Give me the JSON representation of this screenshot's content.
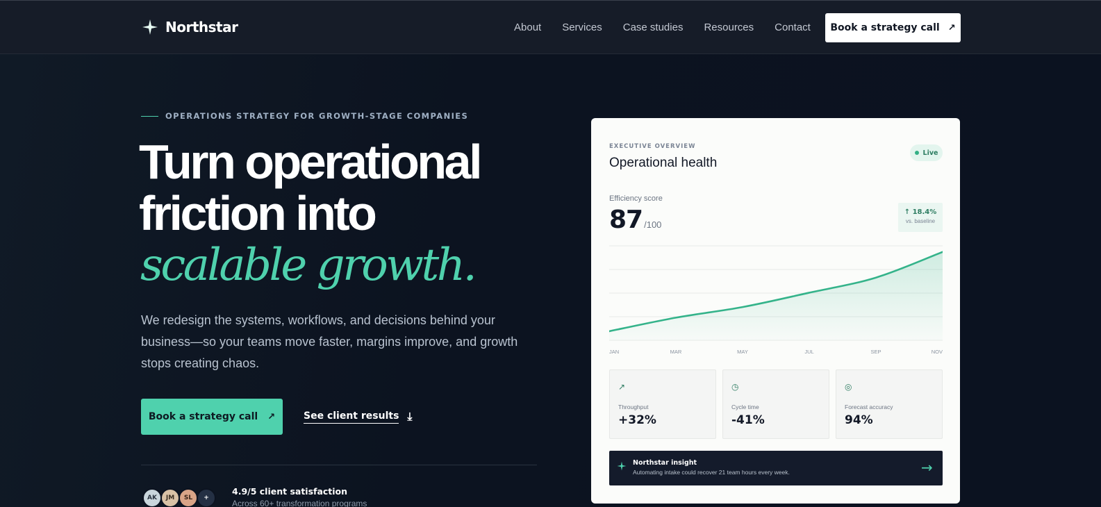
{
  "brand": {
    "name": "Northstar",
    "accent": "#4fd1ad"
  },
  "nav": {
    "links": [
      "About",
      "Services",
      "Case studies",
      "Resources",
      "Contact"
    ],
    "cta_label": "Book a strategy call",
    "cta_icon": "arrow-up-right-icon"
  },
  "hero": {
    "eyebrow": "OPERATIONS STRATEGY FOR GROWTH-STAGE COMPANIES",
    "headline_line1": "Turn operational",
    "headline_line2": "friction into",
    "headline_accent": "scalable growth.",
    "lede": "We redesign the systems, workflows, and decisions behind your business—so your teams move faster, margins improve, and growth stops creating chaos.",
    "primary_cta": "Book a strategy call",
    "secondary_cta": "See client results",
    "avatars": [
      "AK",
      "JM",
      "SL",
      "+"
    ],
    "rating_title": "4.9/5 client satisfaction",
    "rating_sub": "Across 60+ transformation programs"
  },
  "card": {
    "eyebrow": "EXECUTIVE OVERVIEW",
    "title": "Operational health",
    "badge": "Live",
    "score_label": "Efficiency score",
    "score_value": "87",
    "score_denominator": "/100",
    "delta_value": "↑ 18.4%",
    "delta_sub": "vs. baseline",
    "stats": [
      {
        "icon": "trend-up-icon",
        "glyph": "↗",
        "label": "Throughput",
        "value": "+32%"
      },
      {
        "icon": "clock-icon",
        "glyph": "◷",
        "label": "Cycle time",
        "value": "-41%"
      },
      {
        "icon": "target-icon",
        "glyph": "◎",
        "label": "Forecast accuracy",
        "value": "94%"
      }
    ],
    "insight_title": "Northstar insight",
    "insight_text": "Automating intake could recover 21 team hours every week."
  },
  "chart_data": {
    "type": "area",
    "x": [
      "JAN",
      "MAR",
      "MAY",
      "JUL",
      "SEP",
      "NOV"
    ],
    "series": [
      {
        "values": [
          12,
          30,
          44,
          63,
          83,
          117
        ]
      }
    ],
    "ylim": [
      0,
      125
    ],
    "grid": true,
    "line_color": "#34b38a"
  }
}
